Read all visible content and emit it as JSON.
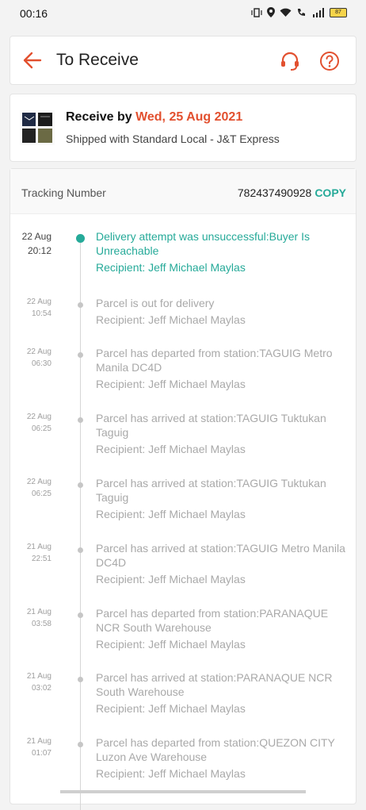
{
  "status_bar": {
    "time": "00:16",
    "battery": "87"
  },
  "header": {
    "title": "To Receive",
    "back_icon": "arrow-left-icon",
    "support_icon": "headset-icon",
    "help_icon": "question-circle-icon",
    "accent": "#e2502f"
  },
  "shipment": {
    "receive_label": "Receive by",
    "receive_date": "Wed, 25 Aug 2021",
    "shipped_with": "Shipped with Standard Local - J&T Express"
  },
  "tracking": {
    "label": "Tracking Number",
    "number": "782437490928",
    "copy_label": "COPY",
    "copy_color": "#26aa99"
  },
  "events": [
    {
      "date": "22 Aug",
      "time": "20:12",
      "text": "Delivery attempt was unsuccessful:Buyer Is Unreachable",
      "recipient": "Recipient: Jeff Michael Maylas"
    },
    {
      "date": "22 Aug",
      "time": "10:54",
      "text": "Parcel is out for delivery",
      "recipient": "Recipient: Jeff Michael Maylas"
    },
    {
      "date": "22 Aug",
      "time": "06:30",
      "text": "Parcel has departed from station:TAGUIG Metro Manila DC4D",
      "recipient": "Recipient: Jeff Michael Maylas"
    },
    {
      "date": "22 Aug",
      "time": "06:25",
      "text": "Parcel has arrived at station:TAGUIG Tuktukan Taguig",
      "recipient": "Recipient: Jeff Michael Maylas"
    },
    {
      "date": "22 Aug",
      "time": "06:25",
      "text": "Parcel has arrived at station:TAGUIG Tuktukan Taguig",
      "recipient": "Recipient: Jeff Michael Maylas"
    },
    {
      "date": "21 Aug",
      "time": "22:51",
      "text": "Parcel has arrived at station:TAGUIG Metro Manila DC4D",
      "recipient": "Recipient: Jeff Michael Maylas"
    },
    {
      "date": "21 Aug",
      "time": "03:58",
      "text": "Parcel has departed from station:PARANAQUE NCR South Warehouse",
      "recipient": "Recipient: Jeff Michael Maylas"
    },
    {
      "date": "21 Aug",
      "time": "03:02",
      "text": "Parcel has arrived at station:PARANAQUE NCR South Warehouse",
      "recipient": "Recipient: Jeff Michael Maylas"
    },
    {
      "date": "21 Aug",
      "time": "01:07",
      "text": "Parcel has departed from station:QUEZON CITY Luzon Ave Warehouse",
      "recipient": "Recipient: Jeff Michael Maylas"
    }
  ]
}
